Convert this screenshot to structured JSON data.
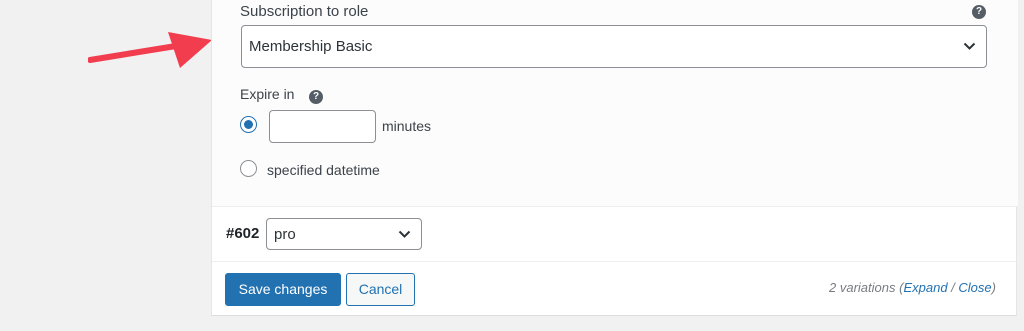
{
  "subscription": {
    "label": "Subscription to role",
    "help_icon": "question-icon",
    "selected_role": "Membership Basic"
  },
  "expire": {
    "label": "Expire in",
    "help_icon": "question-icon",
    "minutes_value": "",
    "minutes_unit": "minutes",
    "minutes_selected": true,
    "datetime_label": "specified datetime",
    "datetime_selected": false
  },
  "variation": {
    "id": "#602",
    "selected_option": "pro"
  },
  "actions": {
    "save_label": "Save changes",
    "cancel_label": "Cancel"
  },
  "summary": {
    "count_text": "2 variations",
    "open_paren": "(",
    "expand_label": "Expand",
    "separator": " / ",
    "close_label": "Close",
    "close_paren": ")"
  },
  "colors": {
    "accent": "#2271b1",
    "annotation_arrow": "#f23d4f"
  }
}
